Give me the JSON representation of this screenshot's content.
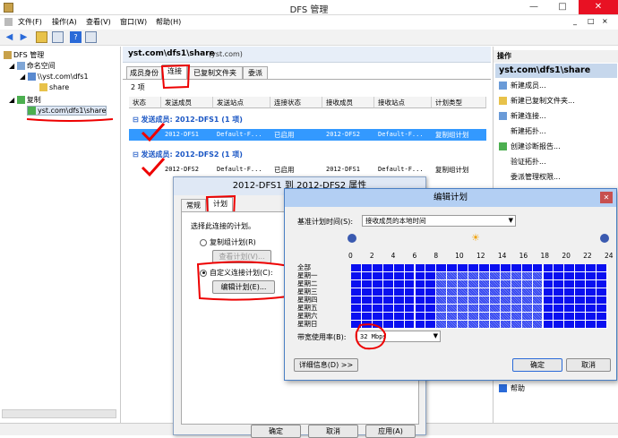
{
  "window": {
    "title": "DFS 管理"
  },
  "menu": {
    "items": [
      "文件(F)",
      "操作(A)",
      "查看(V)",
      "窗口(W)",
      "帮助(H)"
    ],
    "right_controls": [
      "_",
      "□",
      "×"
    ]
  },
  "tree": {
    "root": "DFS 管理",
    "namespaces": "命名空间",
    "ns_path": "\\\\yst.com\\dfs1",
    "ns_share": "share",
    "replication": "复制",
    "rep_group": "yst.com\\dfs1\\share"
  },
  "middle": {
    "title": "yst.com\\dfs1\\share",
    "domain": "(yst.com)",
    "tabs": [
      "成员身份",
      "连接",
      "已复制文件夹",
      "委派"
    ],
    "count": "2 项",
    "columns": [
      "状态",
      "发送成员",
      "发送站点",
      "连接状态",
      "接收成员",
      "接收站点",
      "计划类型"
    ],
    "groups": [
      {
        "label": "发送成员: 2012-DFS1 (1 项)",
        "row": [
          "",
          "2012-DFS1",
          "Default-F...",
          "已启用",
          "2012-DFS2",
          "Default-F...",
          "复制组计划"
        ]
      },
      {
        "label": "发送成员: 2012-DFS2 (1 项)",
        "row": [
          "",
          "2012-DFS2",
          "Default-F...",
          "已启用",
          "2012-DFS1",
          "Default-F...",
          "复制组计划"
        ]
      }
    ]
  },
  "actions": {
    "header": "操作",
    "subheader": "yst.com\\dfs1\\share",
    "items": [
      "新建成员...",
      "新建已复制文件夹...",
      "新建连接...",
      "新建拓扑...",
      "创建诊断报告...",
      "验证拓扑...",
      "委派管理权限...",
      "",
      "",
      "",
      "",
      "",
      "",
      "",
      "",
      "帮助"
    ]
  },
  "props_dialog": {
    "title": "2012-DFS1 到 2012-DFS2 属性",
    "tabs": [
      "常规",
      "计划"
    ],
    "prompt": "选择此连接的计划。",
    "opt1": "复制组计划(R)",
    "opt1_btn": "查看计划(V)...",
    "opt2": "自定义连接计划(C):",
    "edit_btn": "编辑计划(E)...",
    "buttons": [
      "确定",
      "取消",
      "应用(A)"
    ]
  },
  "schedule_dialog": {
    "title": "编辑计划",
    "basis_label": "基准计划时间(S):",
    "basis_value": "接收成员的本地时间",
    "hours": [
      "0",
      "2",
      "4",
      "6",
      "8",
      "10",
      "12",
      "14",
      "16",
      "18",
      "20",
      "22",
      "24"
    ],
    "days": [
      "全部",
      "星期一",
      "星期二",
      "星期三",
      "星期四",
      "星期五",
      "星期六",
      "星期日"
    ],
    "bandwidth_label": "带宽使用率(B):",
    "bandwidth_value": "32 Mbps",
    "details_btn": "详细信息(D) >>",
    "ok": "确定",
    "cancel": "取消",
    "grid_colors": {
      "solid": "#0a10f0",
      "hatched": "#2a3cf0"
    },
    "hatched_hours": [
      8,
      9,
      10,
      11,
      12,
      13,
      14,
      15,
      16,
      17
    ]
  }
}
